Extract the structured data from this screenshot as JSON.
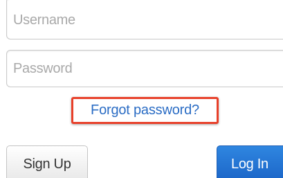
{
  "login_form": {
    "username_placeholder": "Username",
    "password_placeholder": "Password",
    "forgot_password_label": "Forgot password?",
    "signup_label": "Sign Up",
    "login_label": "Log In"
  },
  "colors": {
    "highlight_border": "#e8402a",
    "link": "#2a6cc4",
    "primary_button": "#1a63c6"
  }
}
